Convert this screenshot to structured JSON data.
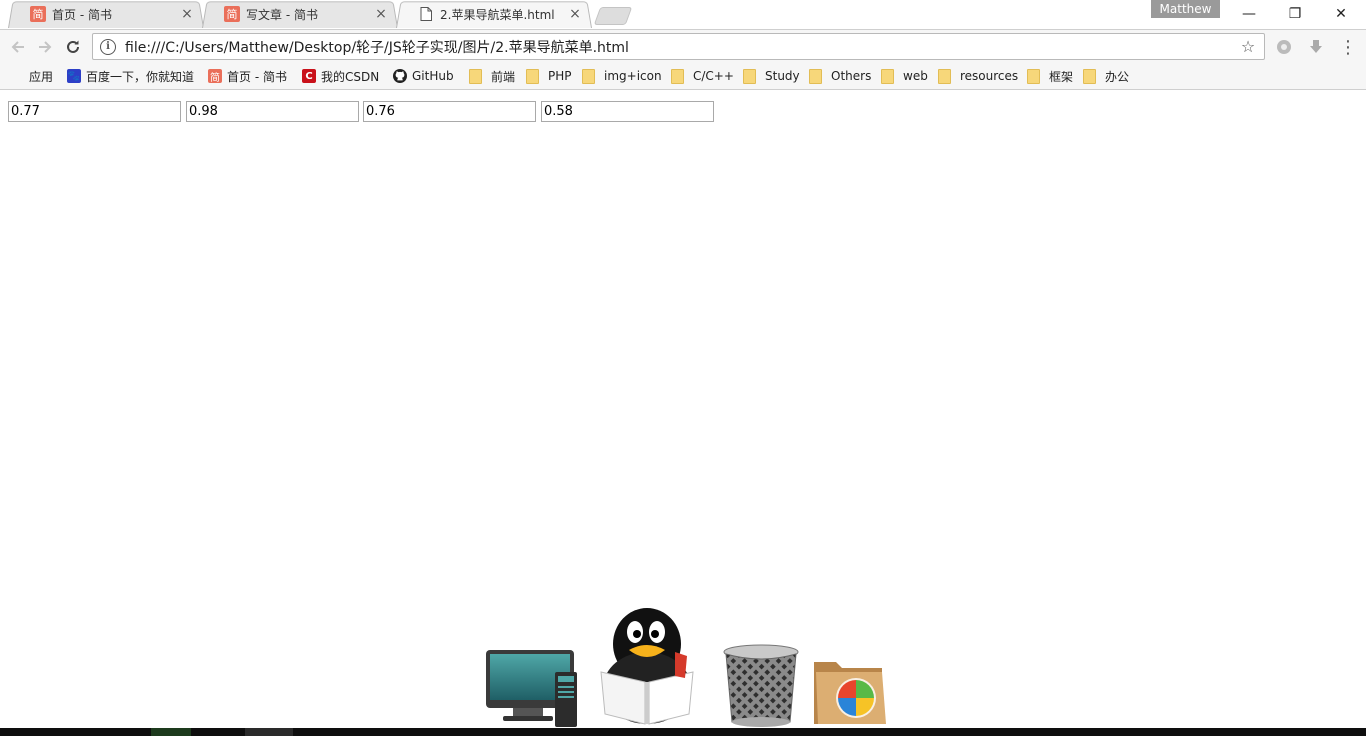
{
  "tabs": [
    {
      "label": "首页 - 简书",
      "icon": "jianshu-icon",
      "favicon_text": "简"
    },
    {
      "label": "写文章 - 简书",
      "icon": "jianshu-icon",
      "favicon_text": "简"
    },
    {
      "label": "2.苹果导航菜单.html",
      "icon": "document-icon",
      "active": true
    }
  ],
  "profile": {
    "name": "Matthew"
  },
  "window_controls": {
    "minimize": "—",
    "restore": "❐",
    "close": "✕"
  },
  "address_bar": {
    "url": "file:///C:/Users/Matthew/Desktop/轮子/JS轮子实现/图片/2.苹果导航菜单.html"
  },
  "bookmarks": [
    {
      "label": "应用",
      "icon": "apps-grid-icon"
    },
    {
      "label": "百度一下，你就知道",
      "icon": "baidu-icon"
    },
    {
      "label": "首页 - 简书",
      "icon": "jianshu-icon"
    },
    {
      "label": "我的CSDN",
      "icon": "csdn-icon"
    },
    {
      "label": "GitHub",
      "icon": "github-icon"
    },
    {
      "label": "前端",
      "icon": "folder-icon"
    },
    {
      "label": "PHP",
      "icon": "folder-icon"
    },
    {
      "label": "img+icon",
      "icon": "folder-icon"
    },
    {
      "label": "C/C++",
      "icon": "folder-icon"
    },
    {
      "label": "Study",
      "icon": "folder-icon"
    },
    {
      "label": "Others",
      "icon": "folder-icon"
    },
    {
      "label": "web",
      "icon": "folder-icon"
    },
    {
      "label": "resources",
      "icon": "folder-icon"
    },
    {
      "label": "框架",
      "icon": "folder-icon"
    },
    {
      "label": "办公",
      "icon": "folder-icon"
    }
  ],
  "inputs": [
    {
      "value": "0.77"
    },
    {
      "value": "0.98"
    },
    {
      "value": "0.76"
    },
    {
      "value": "0.58"
    }
  ],
  "dock": [
    {
      "icon": "computer-icon"
    },
    {
      "icon": "qq-penguin-icon"
    },
    {
      "icon": "trash-icon"
    },
    {
      "icon": "windows-folder-icon"
    }
  ],
  "colors": {
    "jianshu": "#ea6f5a",
    "csdn": "#c9111a",
    "folder": "#f7d77a"
  }
}
